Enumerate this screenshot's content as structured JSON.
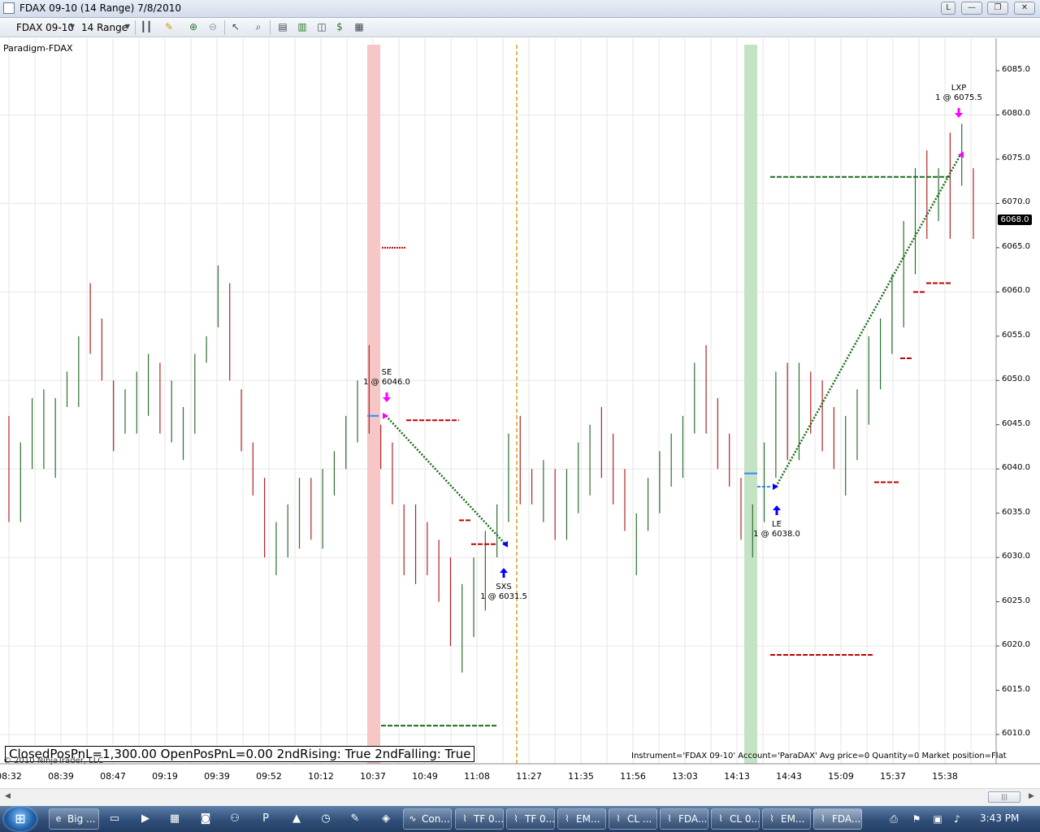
{
  "window": {
    "title": "FDAX 09-10 (14 Range)  7/8/2010",
    "buttons": [
      "L",
      "—",
      "❐",
      "✕"
    ]
  },
  "toolbar": {
    "instrument": "FDAX 09-10",
    "period": "14 Range"
  },
  "chart": {
    "strategy_label": "Paradigm-FDAX",
    "pnl_text": "ClosedPosPnL=1,300.00 OpenPosPnL=0.00 2ndRising: True 2ndFalling: True",
    "copyright": "© 2010 NinjaTrader, LLC",
    "instrument_info": "Instrument='FDAX 09-10' Account='ParaDAX' Avg price=0 Quantity=0 Market position=Flat",
    "current_price": "6068.0",
    "y_ticks": [
      "6085.0",
      "6080.0",
      "6075.0",
      "6070.0",
      "6065.0",
      "6060.0",
      "6055.0",
      "6050.0",
      "6045.0",
      "6040.0",
      "6035.0",
      "6030.0",
      "6025.0",
      "6020.0",
      "6015.0",
      "6010.0"
    ],
    "x_ticks": [
      "08:32",
      "08:39",
      "08:47",
      "09:19",
      "09:39",
      "09:52",
      "10:12",
      "10:37",
      "10:49",
      "11:08",
      "11:27",
      "11:35",
      "11:56",
      "13:03",
      "14:13",
      "14:43",
      "15:09",
      "15:37",
      "15:38"
    ],
    "annotations": [
      {
        "label": "SE",
        "detail": "1 @ 6046.0"
      },
      {
        "label": "SXS",
        "detail": "1 @ 6031.5"
      },
      {
        "label": "LE",
        "detail": "1 @ 6038.0"
      },
      {
        "label": "LXP",
        "detail": "1 @ 6075.5"
      }
    ],
    "colors": {
      "up_bar": "#2d6e2d",
      "down_bar": "#b22222",
      "short_zone": "#f7c6c6",
      "long_zone": "#c4e3c4",
      "marker": "#ff00ff",
      "arrow": "#0000ff",
      "trade_line": "#1a6b1a",
      "vline": "#d4a017"
    }
  },
  "chart_data": {
    "type": "ohlc",
    "ylim": [
      6007.5,
      6087.5
    ],
    "x_tick_labels": [
      "08:32",
      "08:39",
      "08:47",
      "09:19",
      "09:39",
      "09:52",
      "10:12",
      "10:37",
      "10:49",
      "11:08",
      "11:27",
      "11:35",
      "11:56",
      "13:03",
      "14:13",
      "14:43",
      "15:09",
      "15:37",
      "15:38"
    ],
    "bars": [
      [
        6045,
        6046,
        6034,
        6039
      ],
      [
        6037,
        6043,
        6034,
        6042
      ],
      [
        6041,
        6048,
        6040,
        6048
      ],
      [
        6040,
        6049,
        6040,
        6049
      ],
      [
        6040,
        6048,
        6039,
        6047
      ],
      [
        6048,
        6051,
        6047,
        6055
      ],
      [
        6048,
        6055,
        6047,
        6059
      ],
      [
        6059,
        6061,
        6053,
        6054
      ],
      [
        6054,
        6057,
        6050,
        6050
      ],
      [
        6050,
        6050,
        6042,
        6044
      ],
      [
        6044,
        6049,
        6044,
        6048
      ],
      [
        6048,
        6051,
        6044,
        6052
      ],
      [
        6046,
        6053,
        6046,
        6052
      ],
      [
        6052,
        6052,
        6044,
        6046
      ],
      [
        6046,
        6050,
        6043,
        6051
      ],
      [
        6044,
        6047,
        6041,
        6047
      ],
      [
        6047,
        6053,
        6044,
        6053
      ],
      [
        6053,
        6055,
        6052,
        6059
      ],
      [
        6059,
        6063,
        6056,
        6059
      ],
      [
        6056,
        6061,
        6050,
        6050
      ],
      [
        6050,
        6049,
        6042,
        6043
      ],
      [
        6043,
        6043,
        6037,
        6037
      ],
      [
        6037,
        6039,
        6030,
        6031
      ],
      [
        6030,
        6034,
        6028,
        6034
      ],
      [
        6034,
        6036,
        6030,
        6035
      ],
      [
        6035,
        6039,
        6031,
        6036
      ],
      [
        6036,
        6039,
        6032,
        6032
      ],
      [
        6032,
        6040,
        6031,
        6039
      ],
      [
        6039,
        6042,
        6037,
        6041
      ],
      [
        6041,
        6046,
        6040,
        6045
      ],
      [
        6045,
        6050,
        6043,
        6049
      ],
      [
        6049,
        6054,
        6044,
        6046
      ],
      [
        6046,
        6045,
        6040,
        6041
      ],
      [
        6041,
        6043,
        6036,
        6036
      ],
      [
        6036,
        6036,
        6028,
        6028
      ],
      [
        6036,
        6036,
        6027,
        6027
      ],
      [
        6034,
        6034,
        6028,
        6028
      ],
      [
        6032,
        6032,
        6025,
        6025
      ],
      [
        6030,
        6030,
        6020,
        6020
      ],
      [
        6021,
        6027,
        6017,
        6025
      ],
      [
        6025,
        6030,
        6021,
        6029
      ],
      [
        6029,
        6033,
        6024,
        6029
      ],
      [
        6029,
        6036,
        6030,
        6035
      ],
      [
        6035,
        6044,
        6034,
        6043
      ],
      [
        6043,
        6046,
        6036,
        6040
      ],
      [
        6040,
        6040,
        6036,
        6036
      ],
      [
        6036,
        6041,
        6034,
        6038
      ],
      [
        6038,
        6040,
        6032,
        6032
      ],
      [
        6032,
        6040,
        6032,
        6039
      ],
      [
        6039,
        6043,
        6035,
        6041
      ],
      [
        6041,
        6045,
        6037,
        6043
      ],
      [
        6043,
        6047,
        6039,
        6039
      ],
      [
        6039,
        6044,
        6036,
        6038
      ],
      [
        6038,
        6040,
        6033,
        6036
      ],
      [
        6033,
        6035,
        6028,
        6035
      ],
      [
        6035,
        6039,
        6033,
        6039
      ],
      [
        6039,
        6042,
        6035,
        6041
      ],
      [
        6041,
        6044,
        6038,
        6043
      ],
      [
        6043,
        6046,
        6039,
        6046
      ],
      [
        6046,
        6052,
        6044,
        6051
      ],
      [
        6051,
        6054,
        6044,
        6046
      ],
      [
        6046,
        6048,
        6040,
        6043
      ],
      [
        6043,
        6044,
        6038,
        6038
      ],
      [
        6038,
        6039,
        6032,
        6033
      ],
      [
        6033,
        6036,
        6030,
        6035
      ],
      [
        6035,
        6043,
        6034,
        6042
      ],
      [
        6042,
        6051,
        6039,
        6049
      ],
      [
        6049,
        6052,
        6041,
        6043
      ],
      [
        6043,
        6052,
        6041,
        6047
      ],
      [
        6047,
        6051,
        6044,
        6046
      ],
      [
        6046,
        6050,
        6042,
        6044
      ],
      [
        6044,
        6047,
        6040,
        6040
      ],
      [
        6040,
        6046,
        6037,
        6043
      ],
      [
        6043,
        6049,
        6041,
        6048
      ],
      [
        6048,
        6055,
        6045,
        6050
      ],
      [
        6050,
        6057,
        6049,
        6056
      ],
      [
        6056,
        6062,
        6053,
        6060
      ],
      [
        6060,
        6068,
        6056,
        6066
      ],
      [
        6066,
        6074,
        6062,
        6073
      ],
      [
        6073,
        6076,
        6066,
        6069
      ],
      [
        6069,
        6074,
        6068,
        6073
      ],
      [
        6073,
        6078,
        6066,
        6068
      ],
      [
        6074,
        6079,
        6072,
        6075
      ],
      [
        6075,
        6074,
        6066,
        6068
      ]
    ],
    "trades": [
      {
        "label": "SE",
        "price": 6046.0
      },
      {
        "label": "SXS",
        "price": 6031.5
      },
      {
        "label": "LE",
        "price": 6038.0
      },
      {
        "label": "LXP",
        "price": 6075.5
      }
    ]
  },
  "taskbar": {
    "start_label": "Start",
    "items": [
      "Big ...",
      "Con...",
      "TF 0...",
      "TF 0...",
      "EM...",
      "CL ...",
      "FDA...",
      "CL 0...",
      "EM...",
      "FDA..."
    ],
    "clock": "3:43 PM"
  }
}
